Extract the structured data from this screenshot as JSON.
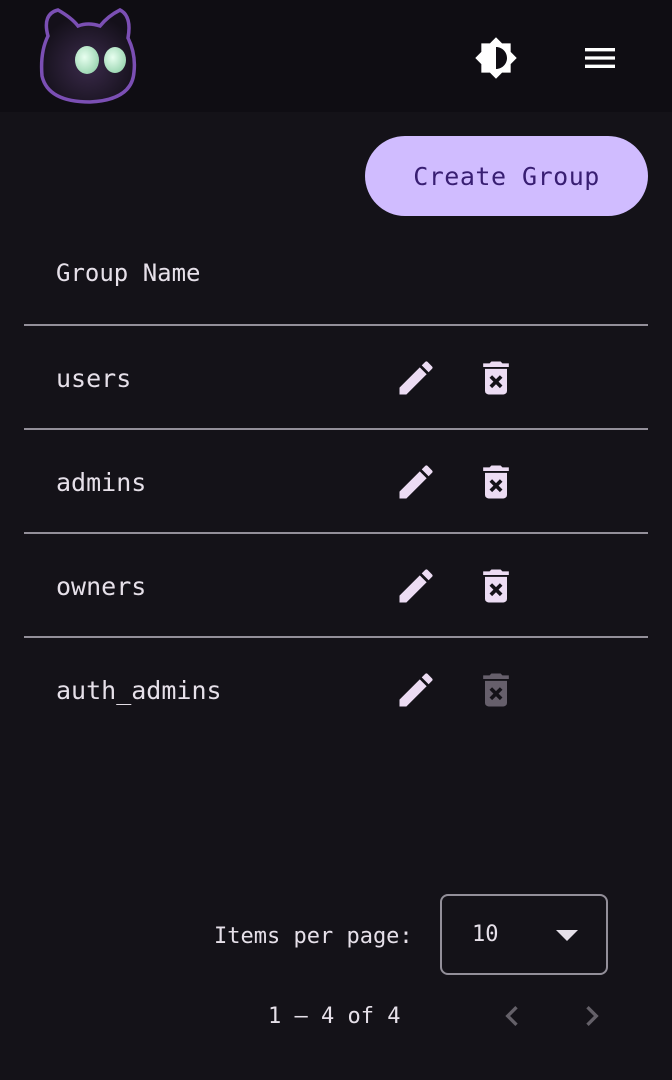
{
  "header": {
    "logo_icon": "cat-logo-icon",
    "theme_toggle_icon": "contrast-icon",
    "menu_icon": "hamburger-menu-icon"
  },
  "actions": {
    "create_label": "Create Group"
  },
  "table": {
    "column_header": "Group Name",
    "rows": [
      {
        "name": "users",
        "delete_enabled": true
      },
      {
        "name": "admins",
        "delete_enabled": true
      },
      {
        "name": "owners",
        "delete_enabled": true
      },
      {
        "name": "auth_admins",
        "delete_enabled": false
      }
    ],
    "edit_icon": "pencil-icon",
    "delete_icon": "trash-x-icon"
  },
  "pagination": {
    "items_per_page_label": "Items per page:",
    "items_per_page_value": "10",
    "range_label": "1 – 4 of 4",
    "prev_icon": "chevron-left-icon",
    "next_icon": "chevron-right-icon"
  },
  "colors": {
    "background": "#141218",
    "topbar": "#0f0d13",
    "primary": "#d0bcff",
    "on_primary": "#381e72",
    "text": "#e6e0e9",
    "divider": "#938f99",
    "icon_fill": "#ecdcf3"
  }
}
